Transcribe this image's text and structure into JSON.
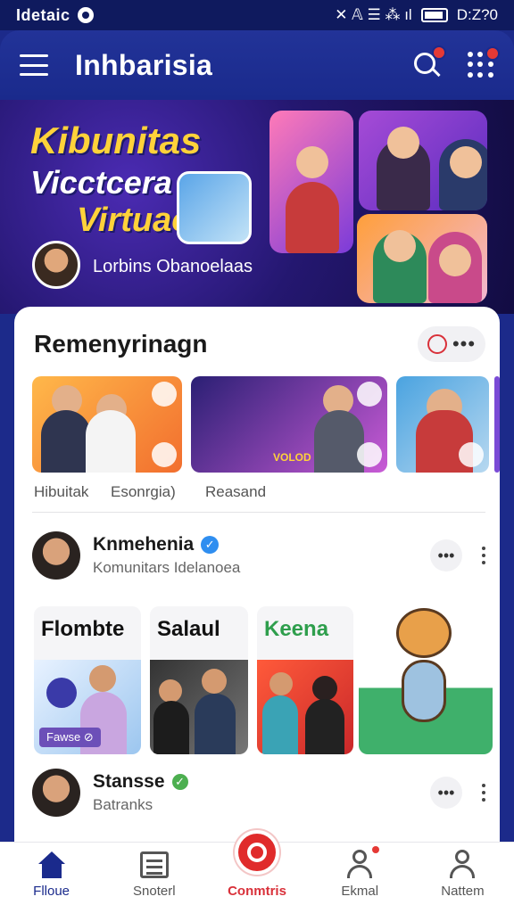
{
  "status_bar": {
    "carrier": "Idetaic",
    "time": "D:Z?0",
    "indicators": "✕ 𝔸 ☰ ⁂ ıl"
  },
  "app_bar": {
    "title": "Inhbarisia"
  },
  "hero": {
    "line1": "Kibunitas",
    "line2": "Vicctcera",
    "line3": "Virtuaol",
    "host_name": "Lorbins Obanoelaas"
  },
  "section": {
    "title": "Remenyrinagn",
    "thumb_labels": [
      "Hibuitak",
      "Esonrgia)",
      "Reasand"
    ],
    "thumb_b_caption": "VOLOD"
  },
  "posts": [
    {
      "name": "Knmehenia",
      "subtitle": "Komunitars Idelanoea",
      "verified": "blue"
    },
    {
      "name": "Stansse",
      "subtitle": "Batranks",
      "verified": "green"
    }
  ],
  "cards": [
    {
      "title": "Flombte",
      "tag": "Fawse ⊘"
    },
    {
      "title": "Salaul"
    },
    {
      "title": "Keena"
    }
  ],
  "bottom_nav": [
    {
      "label": "Flloue",
      "icon": "home-icon"
    },
    {
      "label": "Snoterl",
      "icon": "feed-icon"
    },
    {
      "label": "Conmtris",
      "icon": "community-icon"
    },
    {
      "label": "Ekmal",
      "icon": "person-icon"
    },
    {
      "label": "Nattem",
      "icon": "person-icon"
    }
  ],
  "colors": {
    "primary": "#1a2a8c",
    "accent": "#e02b2b",
    "hero_yellow": "#ffd23a"
  }
}
